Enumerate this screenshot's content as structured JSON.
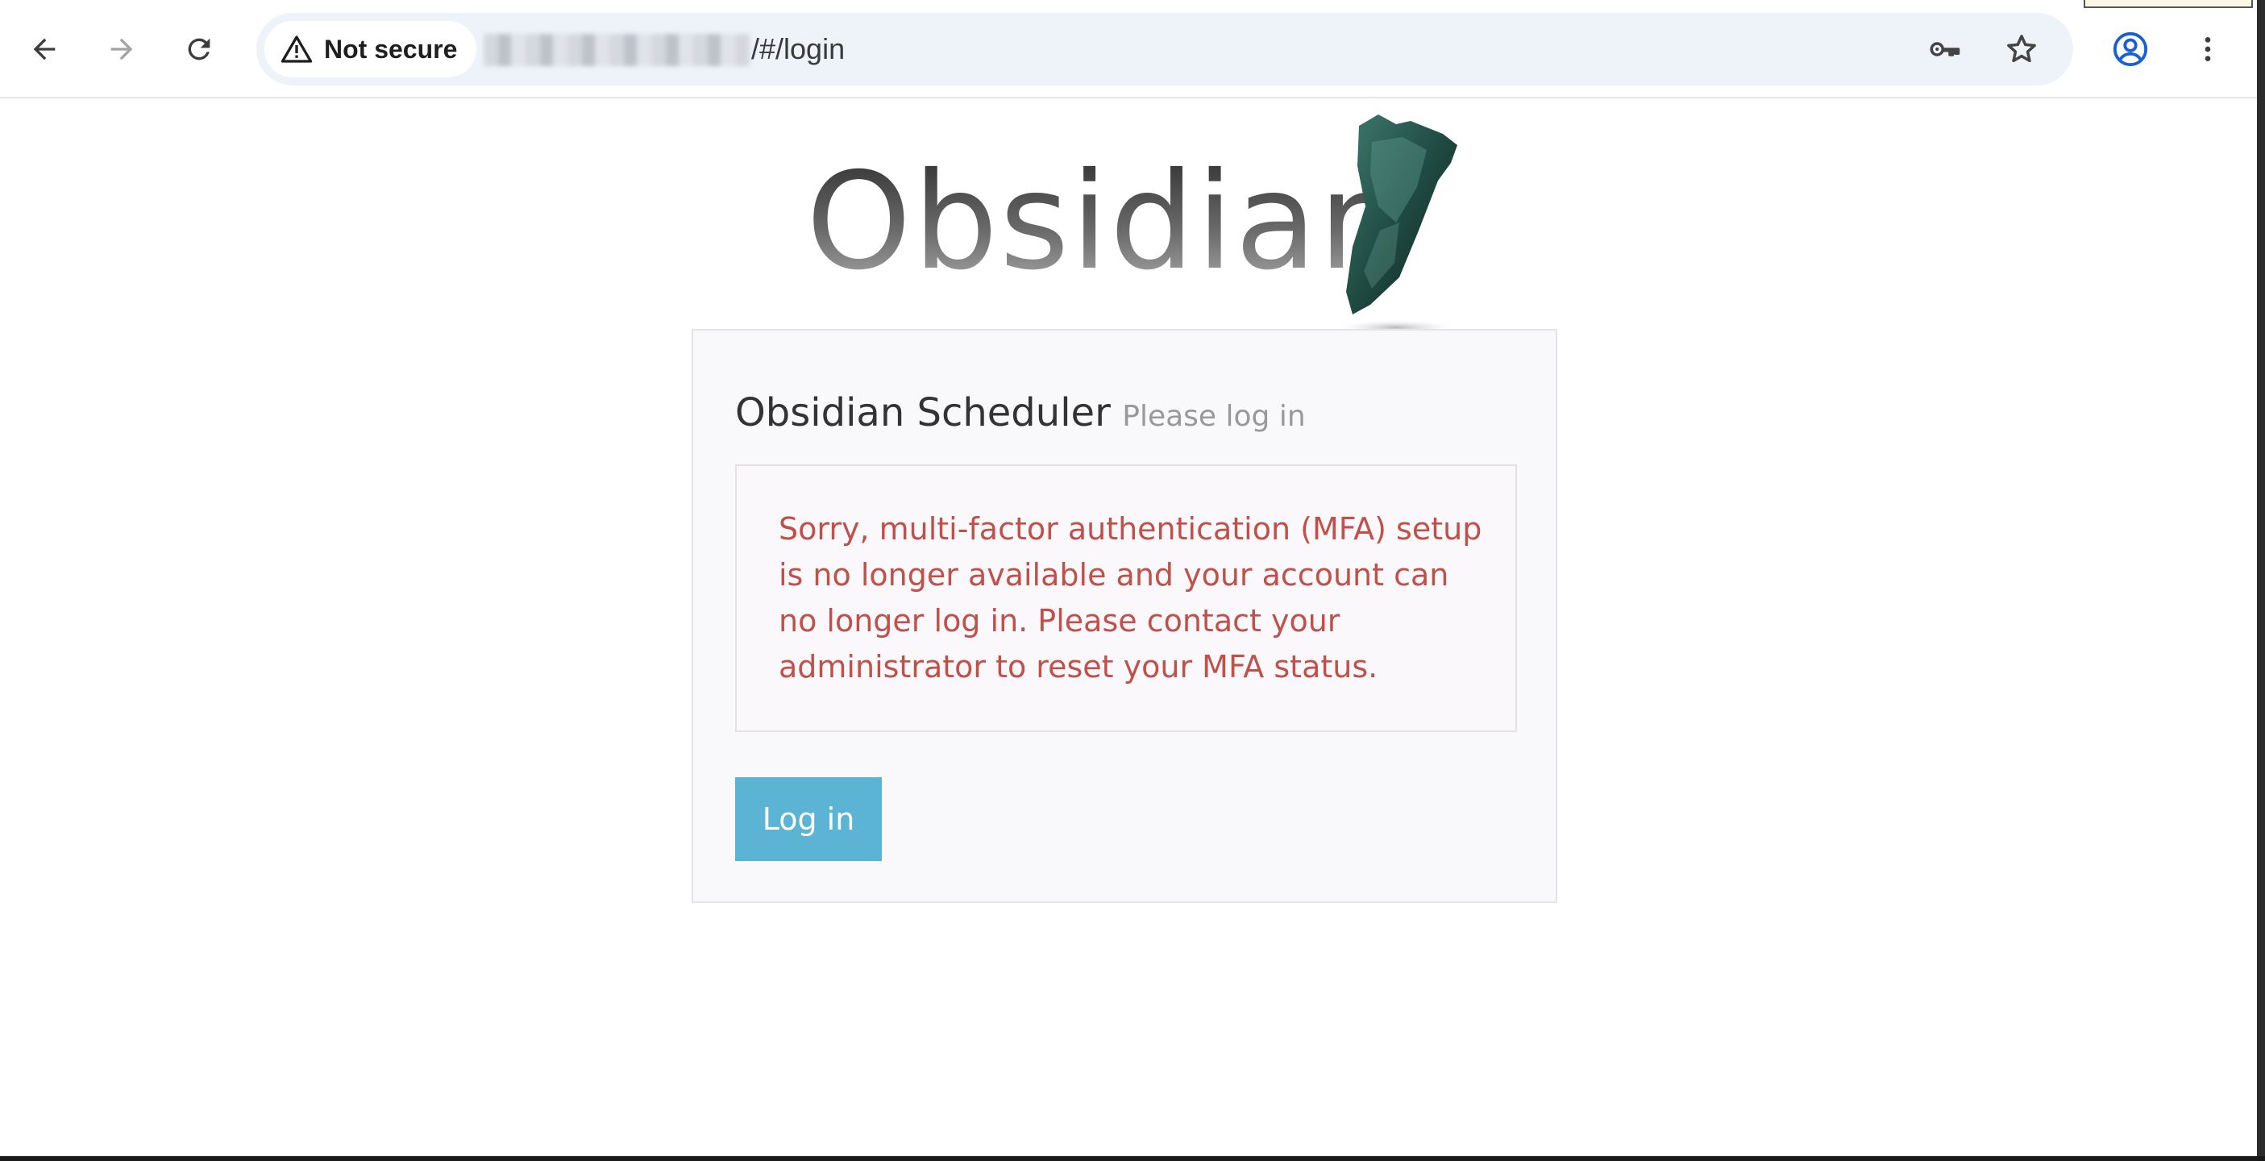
{
  "browser": {
    "security_label": "Not secure",
    "url_path": "/#/login",
    "icons": {
      "back": "back-arrow-icon",
      "forward": "forward-arrow-icon",
      "reload": "reload-icon",
      "warning": "warning-triangle-icon",
      "key": "key-icon",
      "star": "star-icon",
      "profile": "profile-icon",
      "menu": "kebab-menu-icon"
    }
  },
  "logo": {
    "text": "Obsidian"
  },
  "login": {
    "title": "Obsidian Scheduler",
    "subtitle": "Please log in",
    "error_message": "Sorry, multi-factor authentication (MFA) setup is no longer available and your account can no longer log in. Please contact your administrator to reset your MFA status.",
    "button_label": "Log in"
  },
  "colors": {
    "error_text": "#c0504a",
    "button_bg": "#5bb4d4",
    "panel_bg": "#f9f8fb"
  }
}
